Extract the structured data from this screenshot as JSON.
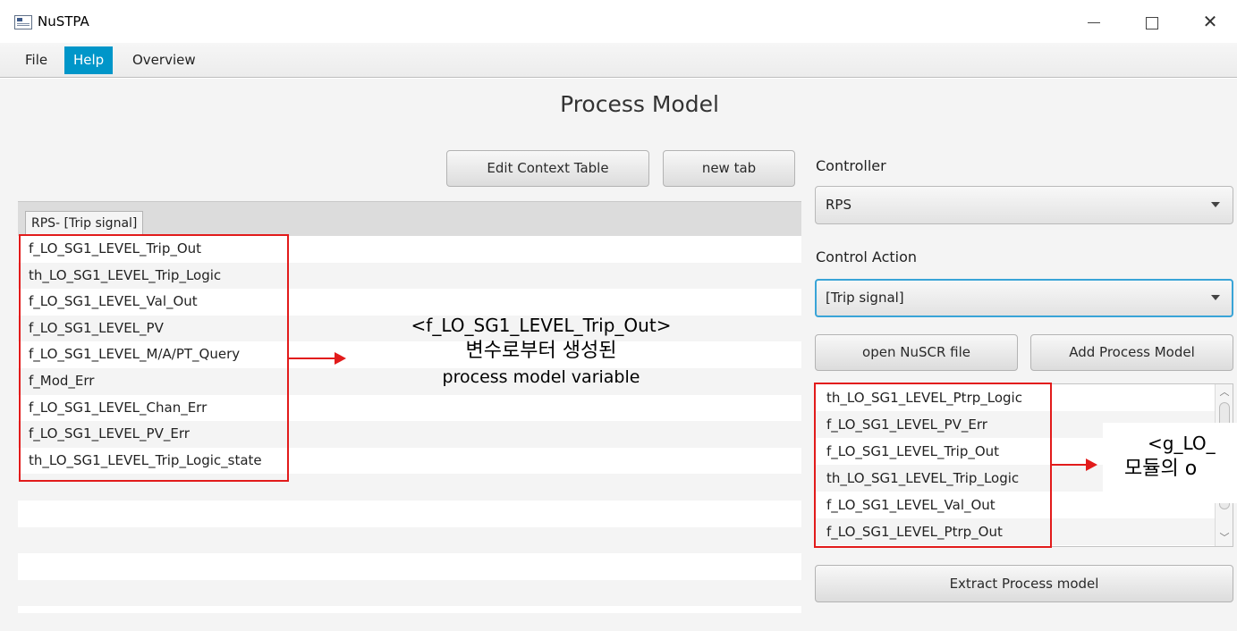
{
  "window": {
    "title": "NuSTPA",
    "icon": "app-window-icon",
    "controls": {
      "minimize": "—",
      "maximize": "☐",
      "close": "✕"
    }
  },
  "menu": {
    "file": "File",
    "help": "Help",
    "overview": "Overview",
    "active": "Help",
    "active_color": "#0096c9"
  },
  "page": {
    "title": "Process Model"
  },
  "toolbar": {
    "edit_context_table": "Edit Context Table",
    "new_tab": "new tab"
  },
  "left_panel": {
    "tab_label": "RPS- [Trip signal]",
    "variables": [
      "f_LO_SG1_LEVEL_Trip_Out",
      "th_LO_SG1_LEVEL_Trip_Logic",
      "f_LO_SG1_LEVEL_Val_Out",
      "f_LO_SG1_LEVEL_PV",
      "f_LO_SG1_LEVEL_M/A/PT_Query",
      "f_Mod_Err",
      "f_LO_SG1_LEVEL_Chan_Err",
      "f_LO_SG1_LEVEL_PV_Err",
      "th_LO_SG1_LEVEL_Trip_Logic_state"
    ]
  },
  "right_panel": {
    "controller_label": "Controller",
    "controller_value": "RPS",
    "control_action_label": "Control Action",
    "control_action_value": "[Trip signal]",
    "open_nuscr": "open NuSCR file",
    "add_process_model": "Add Process Model",
    "outputs": [
      "th_LO_SG1_LEVEL_Ptrp_Logic",
      "f_LO_SG1_LEVEL_PV_Err",
      "f_LO_SG1_LEVEL_Trip_Out",
      "th_LO_SG1_LEVEL_Trip_Logic",
      "f_LO_SG1_LEVEL_Val_Out",
      "f_LO_SG1_LEVEL_Ptrp_Out"
    ],
    "extract_process_model": "Extract Process model"
  },
  "annotations": {
    "left_line1": "<f_LO_SG1_LEVEL_Trip_Out>",
    "left_line2": "변수로부터 생성된",
    "left_line3": "process model variable",
    "right_line1": "<g_LO_",
    "right_line2": "모듈의 o",
    "highlight_color": "#e21b1b"
  }
}
